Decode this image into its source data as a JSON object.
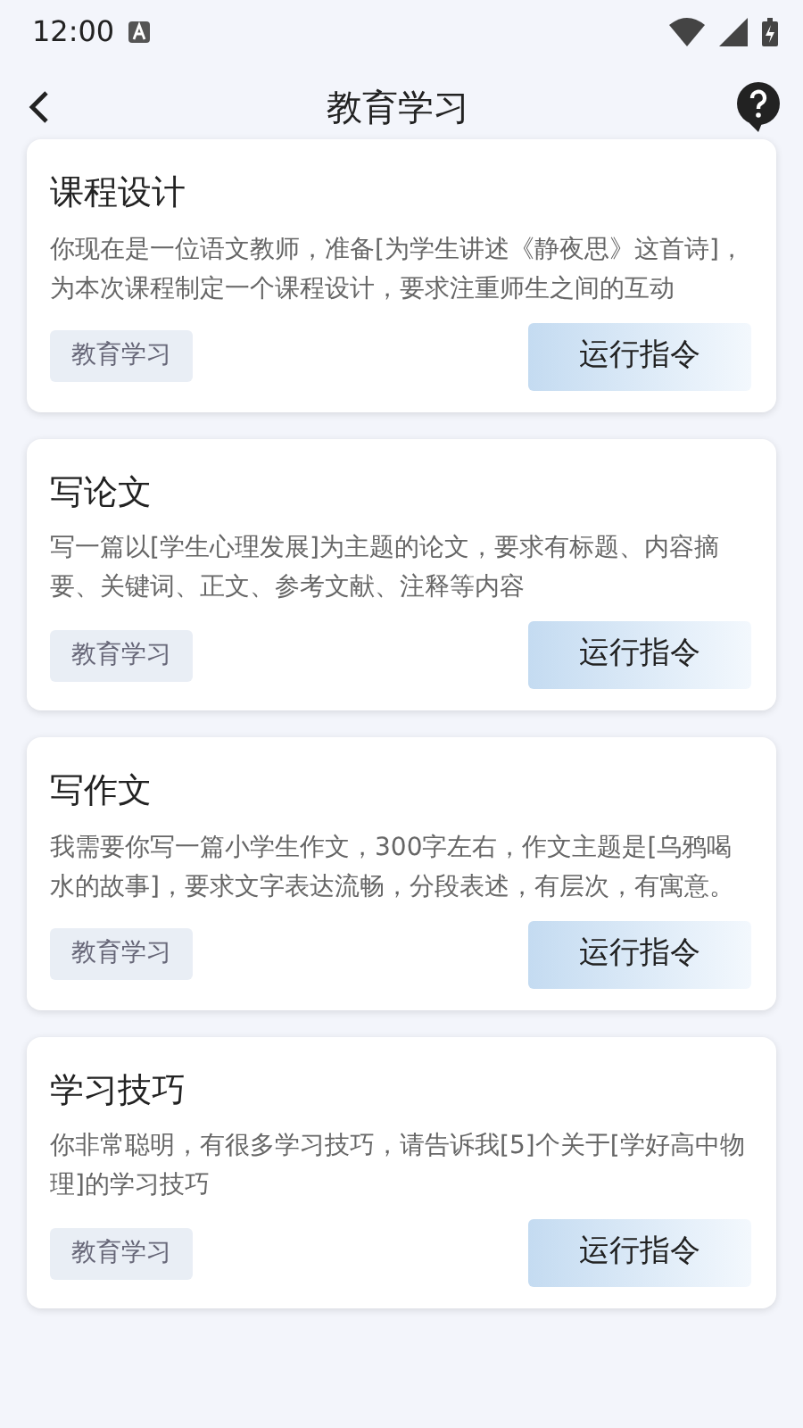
{
  "status_bar": {
    "time": "12:00"
  },
  "header": {
    "title": "教育学习"
  },
  "cards": [
    {
      "title": "课程设计",
      "text": "你现在是一位语文教师，准备[为学生讲述《静夜思》这首诗]，为本次课程制定一个课程设计，要求注重师生之间的互动",
      "tag": "教育学习",
      "button": "运行指令"
    },
    {
      "title": "写论文",
      "text": "写一篇以[学生心理发展]为主题的论文，要求有标题、内容摘要、关键词、正文、参考文献、注释等内容",
      "tag": "教育学习",
      "button": "运行指令"
    },
    {
      "title": "写作文",
      "text": "我需要你写一篇小学生作文，300字左右，作文主题是[乌鸦喝水的故事]，要求文字表达流畅，分段表述，有层次，有寓意。",
      "tag": "教育学习",
      "button": "运行指令"
    },
    {
      "title": "学习技巧",
      "text": "你非常聪明，有很多学习技巧，请告诉我[5]个关于[学好高中物理]的学习技巧",
      "tag": "教育学习",
      "button": "运行指令"
    }
  ]
}
